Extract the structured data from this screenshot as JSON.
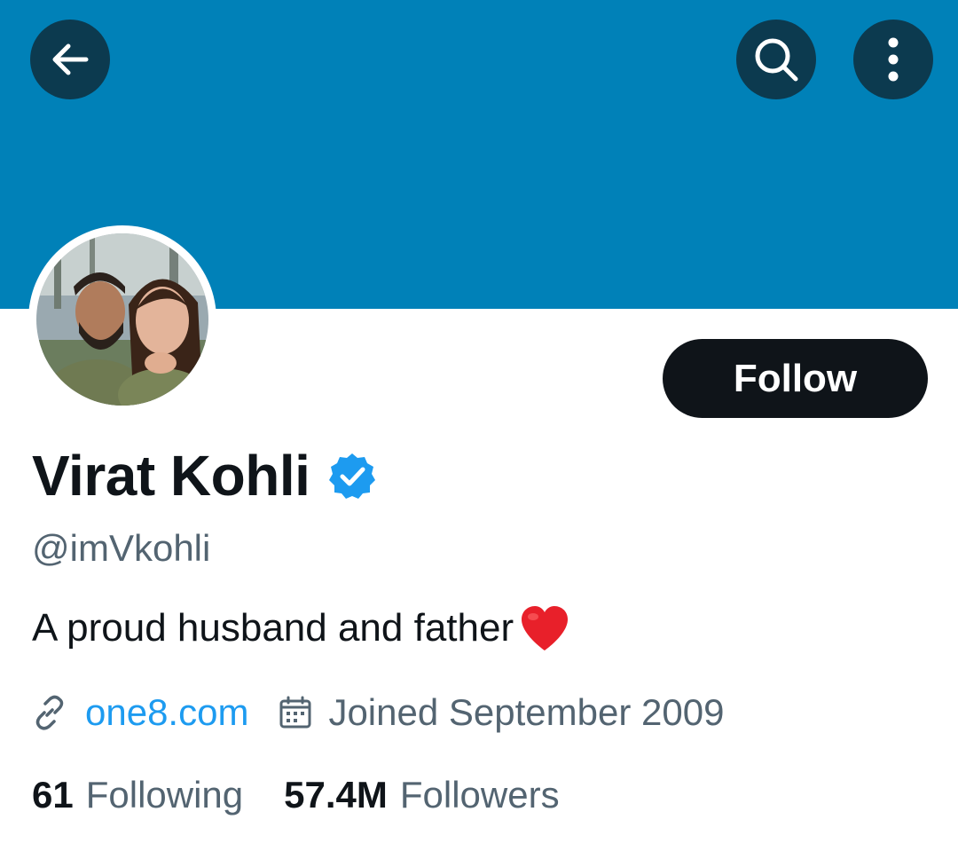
{
  "header": {
    "back_icon": "arrow-left-icon",
    "search_icon": "search-icon",
    "more_icon": "more-vertical-icon",
    "banner_color": "#0081b8"
  },
  "profile": {
    "name": "Virat Kohli",
    "verified_icon": "verified-badge-icon",
    "handle": "@imVkohli",
    "bio": "A proud husband and father",
    "bio_emoji": "heart-emoji",
    "website": "one8.com",
    "joined": "Joined September 2009",
    "follow_label": "Follow"
  },
  "stats": {
    "following_count": "61",
    "following_label": "Following",
    "followers_count": "57.4M",
    "followers_label": "Followers"
  },
  "colors": {
    "accent": "#1d9bf0",
    "secondary_text": "#536471",
    "primary_text": "#0f1419"
  }
}
